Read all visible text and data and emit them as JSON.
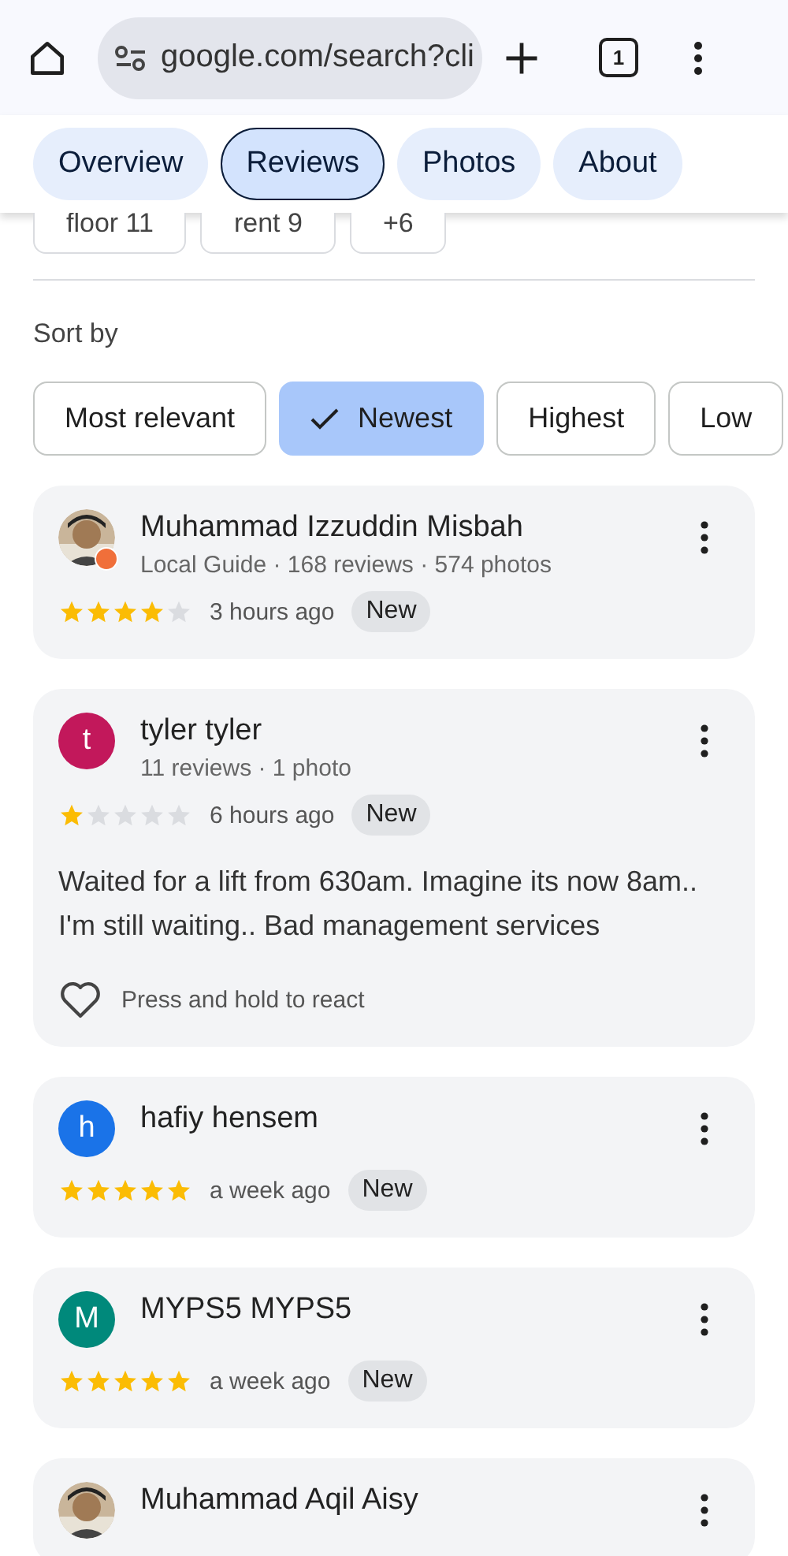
{
  "browser": {
    "url": "google.com/search?cli",
    "tab_count": "1"
  },
  "tabs": [
    {
      "label": "Overview",
      "selected": false
    },
    {
      "label": "Reviews",
      "selected": true
    },
    {
      "label": "Photos",
      "selected": false
    },
    {
      "label": "About",
      "selected": false
    }
  ],
  "topic_chips": [
    "floor 11",
    "rent 9",
    "+6"
  ],
  "sort": {
    "label": "Sort by",
    "options": [
      {
        "label": "Most relevant",
        "selected": false
      },
      {
        "label": "Newest",
        "selected": true
      },
      {
        "label": "Highest",
        "selected": false
      },
      {
        "label": "Low",
        "selected": false
      }
    ]
  },
  "reviews": [
    {
      "name": "Muhammad Izzuddin Misbah",
      "avatar": {
        "kind": "picture",
        "local_guide": true
      },
      "meta": "Local Guide · 168 reviews · 574 photos",
      "stars": 4,
      "time": "3 hours ago",
      "badge": "New"
    },
    {
      "name": "tyler tyler",
      "avatar": {
        "kind": "letter",
        "letter": "t",
        "color": "#c2185b"
      },
      "meta": "11 reviews · 1 photo",
      "stars": 1,
      "time": "6 hours ago",
      "badge": "New",
      "text": "Waited for a lift from 630am. Imagine its now 8am.. I'm still waiting.. Bad management services",
      "react": "Press and hold to react"
    },
    {
      "name": "hafiy hensem",
      "avatar": {
        "kind": "letter",
        "letter": "h",
        "color": "#1a73e8"
      },
      "stars": 5,
      "time": "a week ago",
      "badge": "New"
    },
    {
      "name": "MYPS5 MYPS5",
      "avatar": {
        "kind": "letter",
        "letter": "M",
        "color": "#00897b"
      },
      "stars": 5,
      "time": "a week ago",
      "badge": "New"
    },
    {
      "name": "Muhammad Aqil Aisy",
      "avatar": {
        "kind": "picture"
      }
    }
  ]
}
